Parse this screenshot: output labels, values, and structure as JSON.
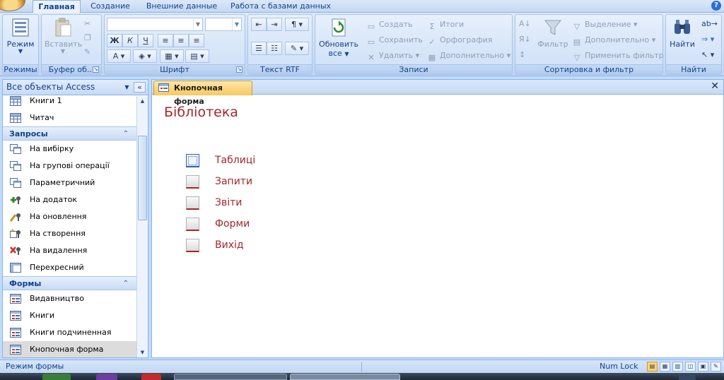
{
  "ribbon_tabs": [
    "Главная",
    "Создание",
    "Внешние данные",
    "Работа с базами данных"
  ],
  "ribbon": {
    "views": {
      "mode_label": "Режим",
      "group_label": "Режимы"
    },
    "clipboard": {
      "paste_label": "Вставить",
      "group_label": "Буфер об..."
    },
    "font": {
      "group_label": "Шрифт",
      "bold": "Ж",
      "italic": "К",
      "underline": "Ч",
      "font_color": "A"
    },
    "rtf": {
      "group_label": "Текст RTF"
    },
    "records": {
      "refresh_label_line1": "Обновить",
      "refresh_label_line2": "все",
      "create": "Создать",
      "save": "Сохранить",
      "delete": "Удалить",
      "totals": "Итоги",
      "spelling": "Орфография",
      "more": "Дополнительно",
      "group_label": "Записи"
    },
    "sort_filter": {
      "filter_label": "Фильтр",
      "selection": "Выделение",
      "advanced": "Дополнительно",
      "apply_filter": "Применить фильтр",
      "group_label": "Сортировка и фильтр"
    },
    "find": {
      "find_label": "Найти",
      "group_label": "Найти"
    }
  },
  "nav": {
    "header": "Все объекты Access",
    "items_top": [
      {
        "label": "Книги 1",
        "icon": "table-icon"
      },
      {
        "label": "Читач",
        "icon": "table-icon"
      }
    ],
    "queries_header": "Запросы",
    "queries": [
      {
        "label": "На вибірку",
        "icon": "select-query-icon"
      },
      {
        "label": "На групові операції",
        "icon": "totals-query-icon"
      },
      {
        "label": "Параметричний",
        "icon": "parameter-query-icon"
      },
      {
        "label": "На додаток",
        "icon": "append-query-icon"
      },
      {
        "label": "На оновлення",
        "icon": "update-query-icon"
      },
      {
        "label": "На створення",
        "icon": "make-table-query-icon"
      },
      {
        "label": "На видалення",
        "icon": "delete-query-icon"
      },
      {
        "label": "Перехресний",
        "icon": "crosstab-query-icon"
      }
    ],
    "forms_header": "Формы",
    "forms": [
      {
        "label": "Видавництво",
        "icon": "form-icon"
      },
      {
        "label": "Книги",
        "icon": "form-icon"
      },
      {
        "label": "Книги подчиненная фор...",
        "icon": "form-icon"
      },
      {
        "label": "Кнопочная форма",
        "icon": "form-icon",
        "selected": true
      }
    ]
  },
  "document": {
    "tab_label": "Кнопочная форма",
    "form_title": "Бібліотека",
    "switchboard_items": [
      {
        "label": "Таблиці",
        "focused": true
      },
      {
        "label": "Запити",
        "focused": false
      },
      {
        "label": "Звіти",
        "focused": false
      },
      {
        "label": "Форми",
        "focused": false
      },
      {
        "label": "Вихід",
        "focused": false
      }
    ]
  },
  "status": {
    "mode_text": "Режим формы",
    "num_lock": "Num Lock"
  },
  "colors": {
    "accent_red": "#a4262c",
    "ribbon_text": "#15428b",
    "selected_tab": "#f9c85e"
  }
}
